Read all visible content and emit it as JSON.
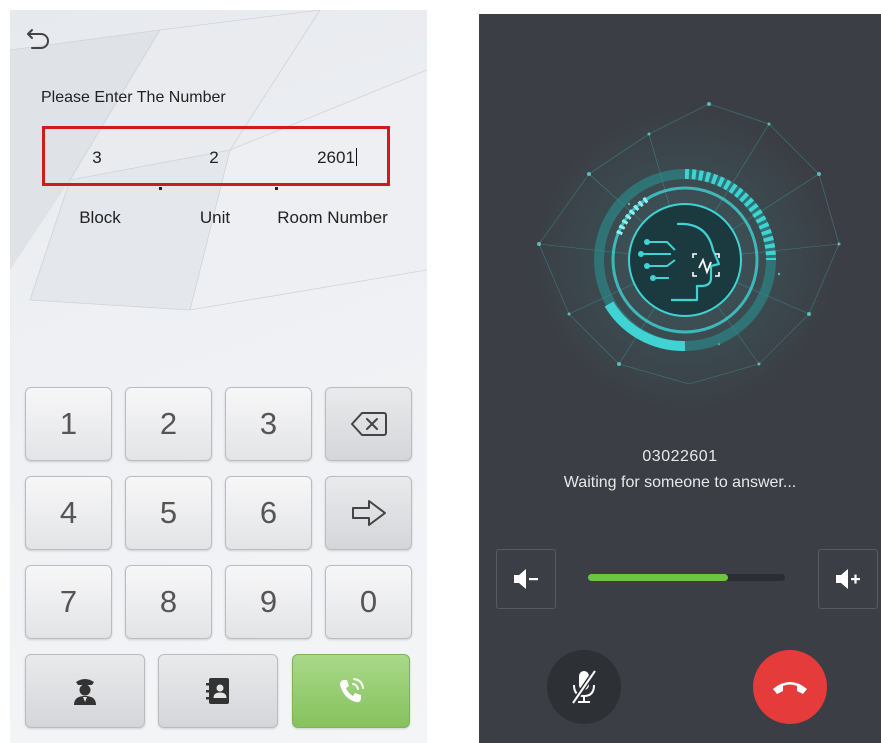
{
  "entry_screen": {
    "prompt": "Please Enter The Number",
    "fields": {
      "block": {
        "label": "Block",
        "value": "3"
      },
      "unit": {
        "label": "Unit",
        "value": "2"
      },
      "room": {
        "label": "Room Number",
        "value": "2601"
      }
    },
    "keypad": [
      "1",
      "2",
      "3",
      "4",
      "5",
      "6",
      "7",
      "8",
      "9",
      "0"
    ],
    "icons": {
      "back": "back-arrow-icon",
      "backspace": "backspace-icon",
      "next": "next-arrow-icon",
      "guard": "security-guard-icon",
      "contacts": "contacts-book-icon",
      "call": "phone-call-icon"
    },
    "colors": {
      "highlight_border": "#d11a1a",
      "call_button": "#8cc563"
    }
  },
  "calling_screen": {
    "number": "03022601",
    "status": "Waiting for someone to answer...",
    "volume_level": 0.71,
    "icons": {
      "avatar": "ai-face-icon",
      "volume_down": "volume-down-icon",
      "volume_up": "volume-up-icon",
      "mute": "microphone-muted-icon",
      "hangup": "hang-up-icon"
    },
    "colors": {
      "background": "#3b3f45",
      "accent": "#3fd3d3",
      "volume_fill": "#6cc644",
      "hangup": "#e53b3b"
    }
  }
}
